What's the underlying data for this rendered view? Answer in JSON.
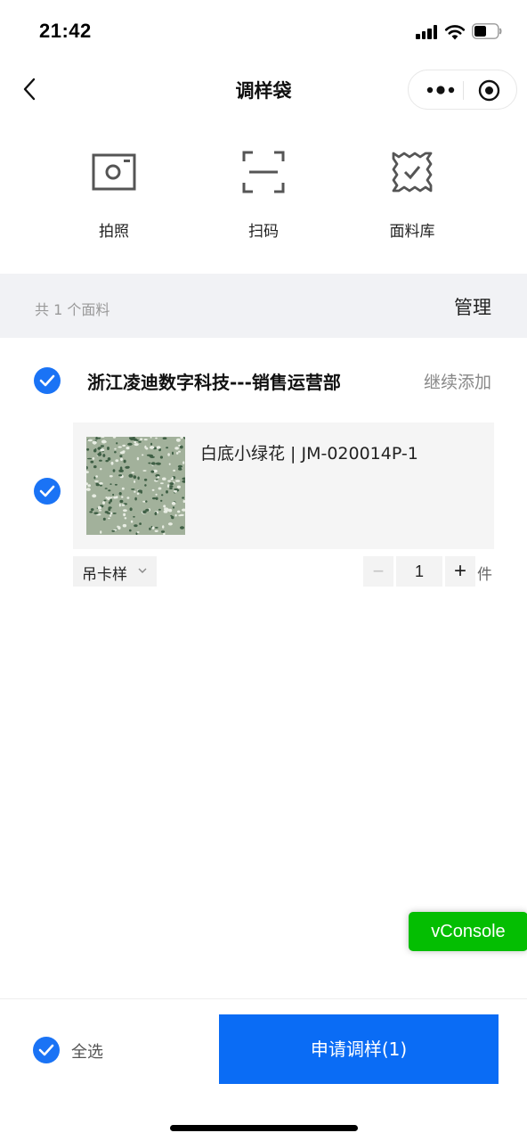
{
  "status_bar": {
    "time": "21:42"
  },
  "nav": {
    "title": "调样袋"
  },
  "actions": [
    {
      "label": "拍照",
      "icon": "camera-icon"
    },
    {
      "label": "扫码",
      "icon": "scan-icon"
    },
    {
      "label": "面料库",
      "icon": "fabric-library-icon"
    }
  ],
  "summary": {
    "count_text": "共 1 个面料",
    "manage_label": "管理"
  },
  "group": {
    "supplier_name": "浙江凌迪数字科技---销售运营部",
    "continue_add_label": "继续添加",
    "checked": true
  },
  "item": {
    "title": "白底小绿花 | JM-020014P-1",
    "checked": true,
    "spec": "吊卡样",
    "quantity": "1",
    "unit": "件",
    "minus_symbol": "−",
    "plus_symbol": "+",
    "swatch_colors": [
      "#a2b19b",
      "#3f5f45",
      "#e8ede3"
    ]
  },
  "footer": {
    "select_all_label": "全选",
    "apply_label": "申请调样(1)",
    "select_all_checked": true
  },
  "debug": {
    "vconsole_label": "vConsole"
  },
  "colors": {
    "accent": "#0a6cf5",
    "check": "#1a73f5",
    "vconsole": "#04be02"
  }
}
